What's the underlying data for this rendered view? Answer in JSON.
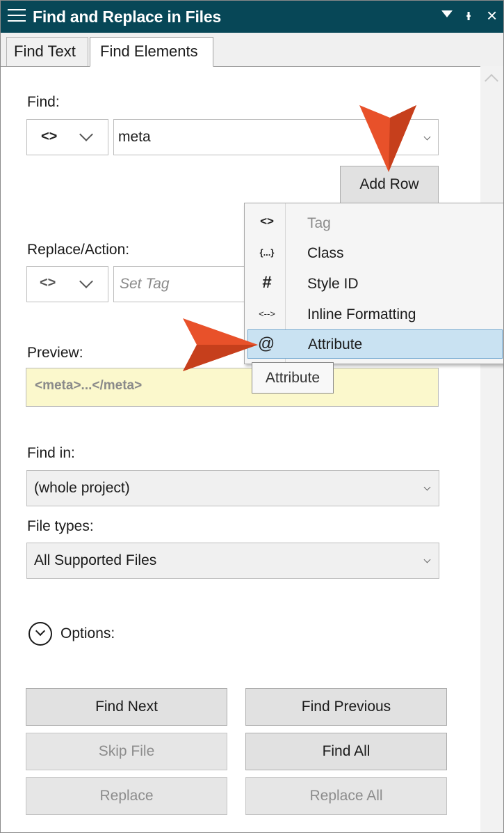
{
  "window": {
    "title": "Find and Replace in Files"
  },
  "tabs": [
    {
      "label": "Find Text"
    },
    {
      "label": "Find Elements"
    }
  ],
  "find": {
    "label": "Find:",
    "type_icon": "<>",
    "value": "meta",
    "add_row_label": "Add Row"
  },
  "replace": {
    "label": "Replace/Action:",
    "placeholder": "Set Tag"
  },
  "menu": {
    "items": [
      {
        "icon": "<>",
        "label": "Tag"
      },
      {
        "icon": "{...}",
        "label": "Class"
      },
      {
        "icon": "#",
        "label": "Style ID"
      },
      {
        "icon": "<-->",
        "label": "Inline Formatting"
      },
      {
        "icon": "@",
        "label": "Attribute"
      }
    ],
    "tooltip": "Attribute"
  },
  "preview": {
    "label": "Preview:",
    "text": "<meta>...</meta>"
  },
  "find_in": {
    "label": "Find in:",
    "value": "(whole project)"
  },
  "file_types": {
    "label": "File types:",
    "value": "All Supported Files"
  },
  "options": {
    "label": "Options:"
  },
  "buttons": {
    "find_next": "Find Next",
    "find_previous": "Find Previous",
    "skip_file": "Skip File",
    "find_all": "Find All",
    "replace": "Replace",
    "replace_all": "Replace All"
  },
  "colors": {
    "titlebar": "#074757",
    "arrow": "#e8512a",
    "menu_highlight": "#c9e2f2",
    "preview_bg": "#fbf8cc"
  }
}
